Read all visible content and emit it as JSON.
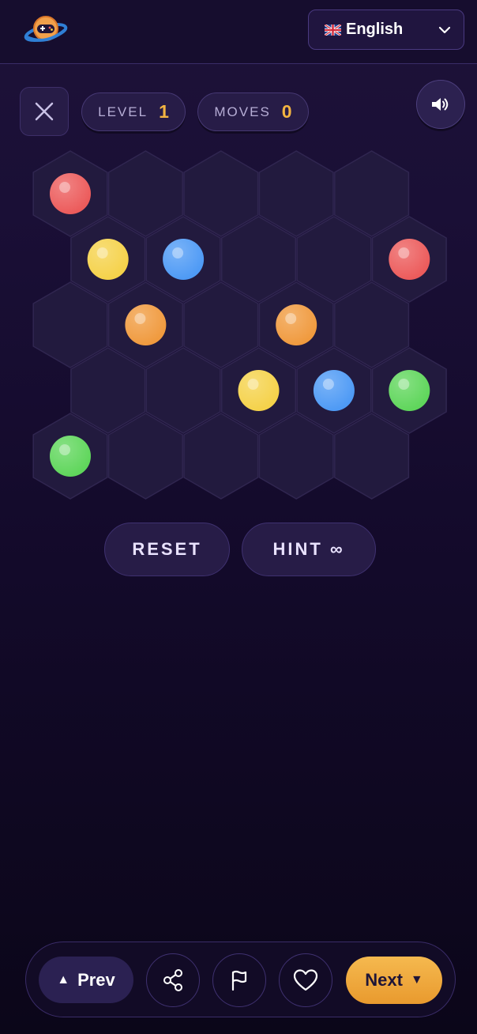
{
  "header": {
    "logo_icon": "game-planet-logo-icon",
    "language": {
      "flag_icon": "uk-flag-icon",
      "label": "English",
      "dropdown_icon": "chevron-down-icon"
    }
  },
  "hud": {
    "close_icon": "close-icon",
    "level_label": "LEVEL",
    "level_value": "1",
    "moves_label": "MOVES",
    "moves_value": "0",
    "sound_icon": "speaker-icon"
  },
  "colors": {
    "red": "#ec5b5b",
    "yellow": "#f5d24a",
    "blue": "#4e9af5",
    "orange": "#f09a3e",
    "green": "#5fd65b",
    "accent": "#f3b441"
  },
  "board": {
    "rows": [
      [
        "red",
        null,
        null,
        null,
        null
      ],
      [
        "yellow",
        "blue",
        null,
        null,
        "red"
      ],
      [
        null,
        "orange",
        null,
        "orange",
        null
      ],
      [
        null,
        null,
        "yellow",
        "blue",
        "green"
      ],
      [
        "green",
        null,
        null,
        null,
        null
      ]
    ]
  },
  "actions": {
    "reset_label": "RESET",
    "hint_label": "HINT ∞"
  },
  "nav": {
    "prev_label": "Prev",
    "prev_icon": "triangle-up-icon",
    "share_icon": "share-icon",
    "flag_icon": "flag-icon",
    "heart_icon": "heart-icon",
    "next_label": "Next",
    "next_icon": "triangle-down-icon"
  }
}
